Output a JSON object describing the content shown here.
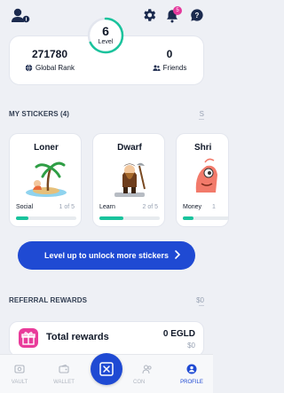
{
  "header": {
    "notification_count": "5"
  },
  "stats": {
    "global_rank_value": "271780",
    "global_rank_label": "Global Rank",
    "level_value": "6",
    "level_label": "Level",
    "level_progress": 0.68,
    "friends_value": "0",
    "friends_label": "Friends"
  },
  "stickers_section": {
    "title": "MY STICKERS (4)",
    "see_all": "S"
  },
  "stickers": [
    {
      "name": "Loner",
      "category": "Social",
      "count": "1 of 5",
      "progress": 0.2
    },
    {
      "name": "Dwarf",
      "category": "Learn",
      "count": "2 of 5",
      "progress": 0.4
    },
    {
      "name": "Shri",
      "category": "Money",
      "count": "1",
      "progress": 0.2
    }
  ],
  "cta": {
    "label": "Level up to unlock more stickers"
  },
  "referral_section": {
    "title": "REFERRAL REWARDS",
    "side_value": "$0"
  },
  "referral": {
    "title": "Total rewards",
    "value": "0 EGLD",
    "usd": "$0"
  },
  "nav": {
    "items": [
      {
        "label": "VAULT"
      },
      {
        "label": "WALLET"
      },
      {
        "label": "CON"
      },
      {
        "label": "PROFILE"
      }
    ]
  },
  "colors": {
    "accent": "#1f4ad3",
    "success": "#19c39c",
    "pink": "#e93b9a"
  }
}
